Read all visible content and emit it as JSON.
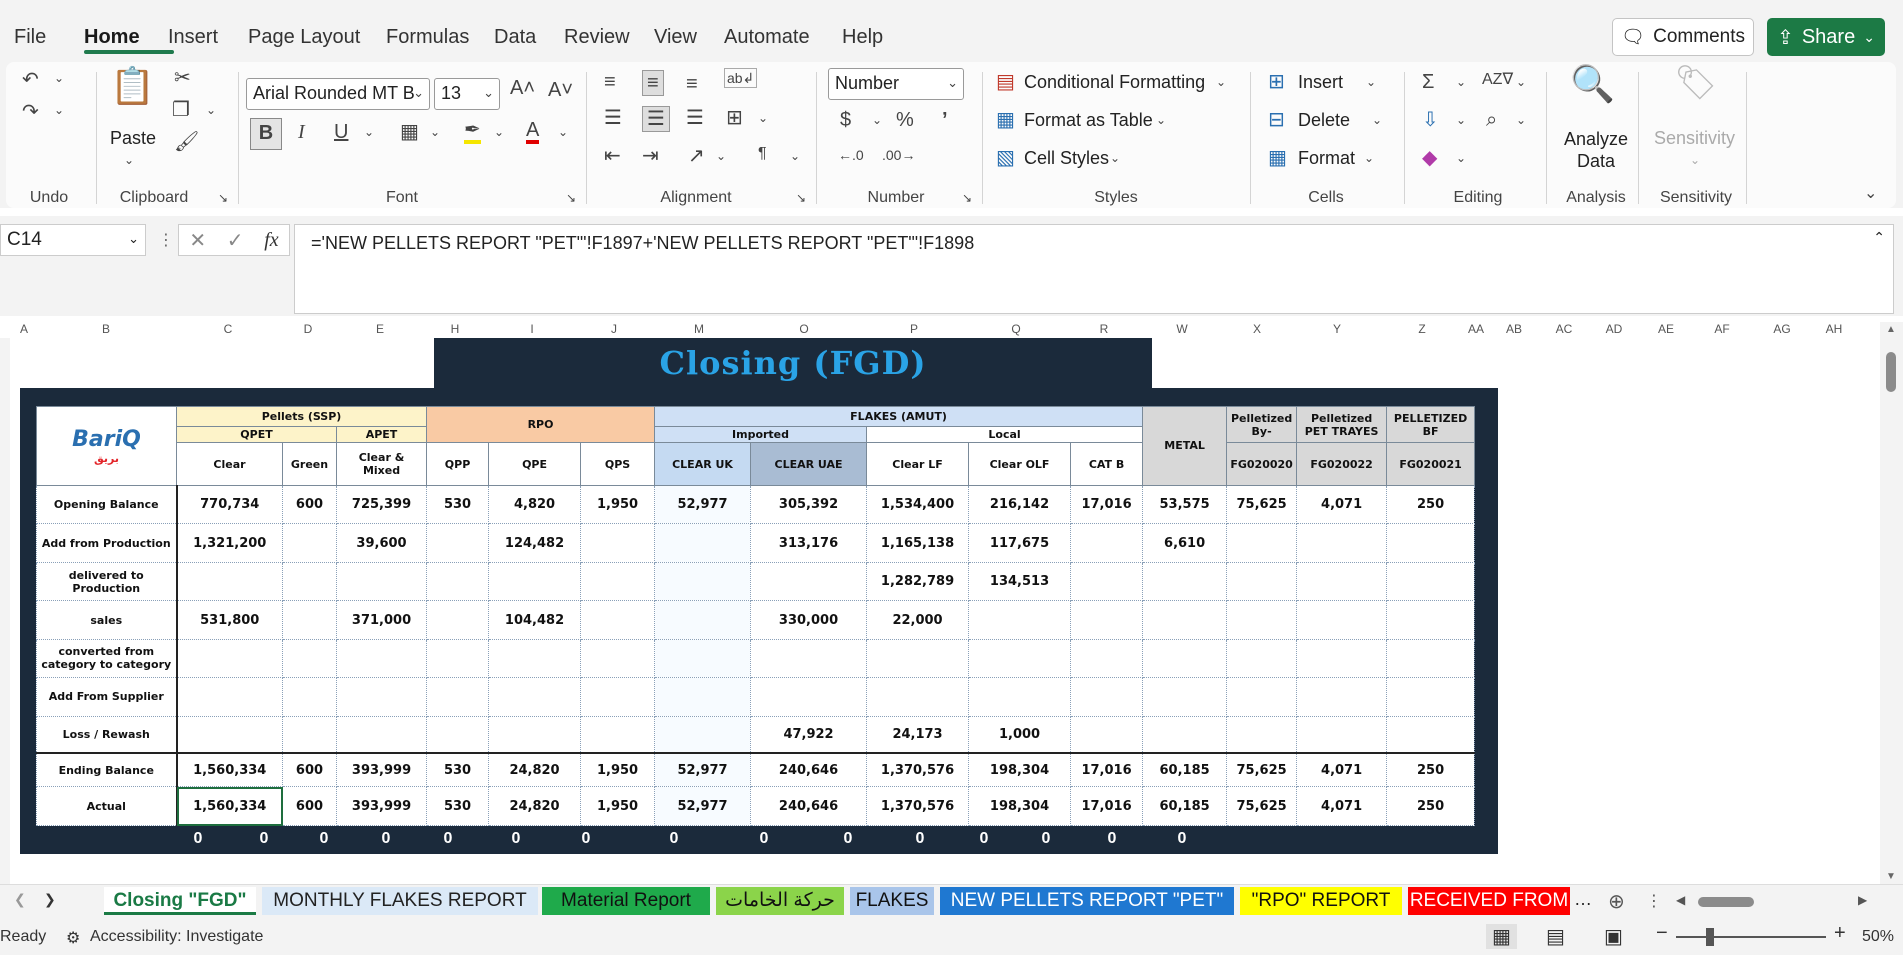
{
  "menu": {
    "tabs": [
      "File",
      "Home",
      "Insert",
      "Page Layout",
      "Formulas",
      "Data",
      "Review",
      "View",
      "Automate",
      "Help"
    ],
    "active": "Home",
    "comments_label": "Comments",
    "share_label": "Share"
  },
  "ribbon": {
    "undo_group": "Undo",
    "paste_label": "Paste",
    "clipboard_group": "Clipboard",
    "font_name": "Arial Rounded MT B",
    "font_size": "13",
    "font_group": "Font",
    "bold": "B",
    "italic": "I",
    "underline": "U",
    "alignment_group": "Alignment",
    "number_format": "Number",
    "number_group": "Number",
    "conditional_formatting": "Conditional Formatting",
    "format_as_table": "Format as Table",
    "cell_styles": "Cell Styles",
    "styles_group": "Styles",
    "insert": "Insert",
    "delete": "Delete",
    "format": "Format",
    "cells_group": "Cells",
    "editing_group": "Editing",
    "analyze_data": "Analyze Data",
    "analysis_group": "Analysis",
    "sensitivity": "Sensitivity",
    "sensitivity_group": "Sensitivity"
  },
  "formula_bar": {
    "cell_ref": "C14",
    "formula": "='NEW PELLETS REPORT \"PET\"'!F1897+'NEW PELLETS REPORT \"PET\"'!F1898"
  },
  "columns": [
    "A",
    "B",
    "C",
    "D",
    "E",
    "H",
    "I",
    "J",
    "M",
    "O",
    "P",
    "Q",
    "R",
    "W",
    "X",
    "Y",
    "Z",
    "AA",
    "AB",
    "AC",
    "AD",
    "AE",
    "AF",
    "AG",
    "AH"
  ],
  "sheet": {
    "title": "Closing (FGD)",
    "logo_text": "BariQ",
    "logo_arabic": "بريق",
    "headers": {
      "pellets": "Pellets (SSP)",
      "qpet": "QPET",
      "apet": "APET",
      "rpo": "RPO",
      "flakes": "FLAKES (AMUT)",
      "imported": "Imported",
      "local": "Local",
      "metal": "METAL",
      "pel_by": "Pelletized By-",
      "pel_pet": "Pelletized PET TRAYES",
      "pel_bf": "PELLETIZED BF",
      "fg1": "FG020020",
      "fg2": "FG020022",
      "fg3": "FG020021",
      "sub": [
        "Clear",
        "Green",
        "Clear & Mixed",
        "QPP",
        "QPE",
        "QPS",
        "CLEAR UK",
        "CLEAR UAE",
        "Clear LF",
        "Clear OLF",
        "CAT B"
      ]
    },
    "rows": [
      {
        "label": "Opening Balance",
        "values": [
          "770,734",
          "600",
          "725,399",
          "530",
          "4,820",
          "1,950",
          "52,977",
          "305,392",
          "1,534,400",
          "216,142",
          "17,016",
          "53,575",
          "75,625",
          "4,071",
          "250"
        ]
      },
      {
        "label": "Add from Production",
        "values": [
          "1,321,200",
          "",
          "39,600",
          "",
          "124,482",
          "",
          "",
          "313,176",
          "1,165,138",
          "117,675",
          "",
          "6,610",
          "",
          "",
          ""
        ]
      },
      {
        "label": "delivered to Production",
        "values": [
          "",
          "",
          "",
          "",
          "",
          "",
          "",
          "",
          "1,282,789",
          "134,513",
          "",
          "",
          "",
          "",
          ""
        ]
      },
      {
        "label": "sales",
        "values": [
          "531,800",
          "",
          "371,000",
          "",
          "104,482",
          "",
          "",
          "330,000",
          "22,000",
          "",
          "",
          "",
          "",
          "",
          ""
        ]
      },
      {
        "label": "converted from category to category",
        "values": [
          "",
          "",
          "",
          "",
          "",
          "",
          "",
          "",
          "",
          "",
          "",
          "",
          "",
          "",
          ""
        ]
      },
      {
        "label": "Add From Supplier",
        "values": [
          "",
          "",
          "",
          "",
          "",
          "",
          "",
          "",
          "",
          "",
          "",
          "",
          "",
          "",
          ""
        ]
      },
      {
        "label": "Loss / Rewash",
        "values": [
          "",
          "",
          "",
          "",
          "",
          "",
          "",
          "47,922",
          "24,173",
          "1,000",
          "",
          "",
          "",
          "",
          ""
        ]
      },
      {
        "label": "Ending Balance",
        "values": [
          "1,560,334",
          "600",
          "393,999",
          "530",
          "24,820",
          "1,950",
          "52,977",
          "240,646",
          "1,370,576",
          "198,304",
          "17,016",
          "60,185",
          "75,625",
          "4,071",
          "250"
        ]
      },
      {
        "label": "Actual",
        "values": [
          "1,560,334",
          "600",
          "393,999",
          "530",
          "24,820",
          "1,950",
          "52,977",
          "240,646",
          "1,370,576",
          "198,304",
          "17,016",
          "60,185",
          "75,625",
          "4,071",
          "250"
        ]
      }
    ],
    "diff_row": [
      "0",
      "0",
      "0",
      "0",
      "0",
      "0",
      "0",
      "0",
      "0",
      "0",
      "0",
      "0",
      "0",
      "0",
      "0"
    ]
  },
  "sheet_tabs": [
    {
      "label": "Closing \"FGD\"",
      "color": "#ffffff"
    },
    {
      "label": "MONTHLY FLAKES REPORT",
      "color": "#dbe9f7"
    },
    {
      "label": "Material Report",
      "color": "#1faa4b"
    },
    {
      "label": "حركة الخامات",
      "color": "#8bd44a"
    },
    {
      "label": "FLAKES",
      "color": "#a9c5ea"
    },
    {
      "label": "NEW PELLETS REPORT \"PET\"",
      "color": "#1f78d1"
    },
    {
      "label": "\"RPO\" REPORT",
      "color": "#ffff00"
    },
    {
      "label": "RECEIVED FROM",
      "color": "#ff0000"
    }
  ],
  "status": {
    "ready": "Ready",
    "accessibility": "Accessibility: Investigate",
    "zoom": "50%"
  }
}
